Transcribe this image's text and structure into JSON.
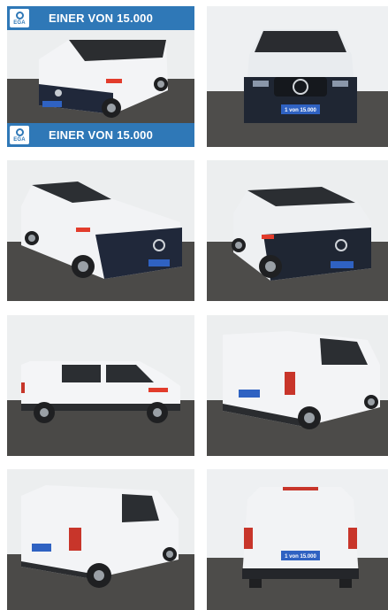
{
  "badge": {
    "banner_text": "EINER VON 15.000",
    "logo_text": "EGA",
    "brand_color": "#2f78b7"
  },
  "plate_text": "1 von 15.000",
  "gallery": {
    "photos": [
      {
        "view": "front-left three-quarter, with promotional banners"
      },
      {
        "view": "front"
      },
      {
        "view": "front-left three-quarter"
      },
      {
        "view": "front-right three-quarter"
      },
      {
        "view": "left side"
      },
      {
        "view": "rear-right three-quarter"
      },
      {
        "view": "rear-left three-quarter"
      },
      {
        "view": "rear"
      }
    ]
  }
}
